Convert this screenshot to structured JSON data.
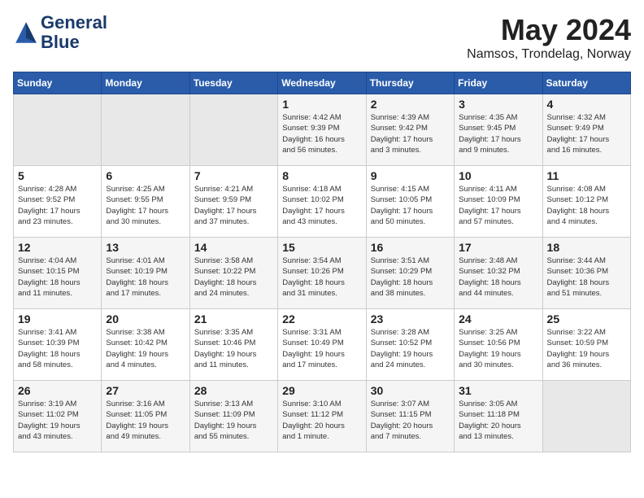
{
  "header": {
    "logo_line1": "General",
    "logo_line2": "Blue",
    "month_year": "May 2024",
    "location": "Namsos, Trondelag, Norway"
  },
  "days_of_week": [
    "Sunday",
    "Monday",
    "Tuesday",
    "Wednesday",
    "Thursday",
    "Friday",
    "Saturday"
  ],
  "weeks": [
    [
      {
        "day": "",
        "content": ""
      },
      {
        "day": "",
        "content": ""
      },
      {
        "day": "",
        "content": ""
      },
      {
        "day": "1",
        "content": "Sunrise: 4:42 AM\nSunset: 9:39 PM\nDaylight: 16 hours\nand 56 minutes."
      },
      {
        "day": "2",
        "content": "Sunrise: 4:39 AM\nSunset: 9:42 PM\nDaylight: 17 hours\nand 3 minutes."
      },
      {
        "day": "3",
        "content": "Sunrise: 4:35 AM\nSunset: 9:45 PM\nDaylight: 17 hours\nand 9 minutes."
      },
      {
        "day": "4",
        "content": "Sunrise: 4:32 AM\nSunset: 9:49 PM\nDaylight: 17 hours\nand 16 minutes."
      }
    ],
    [
      {
        "day": "5",
        "content": "Sunrise: 4:28 AM\nSunset: 9:52 PM\nDaylight: 17 hours\nand 23 minutes."
      },
      {
        "day": "6",
        "content": "Sunrise: 4:25 AM\nSunset: 9:55 PM\nDaylight: 17 hours\nand 30 minutes."
      },
      {
        "day": "7",
        "content": "Sunrise: 4:21 AM\nSunset: 9:59 PM\nDaylight: 17 hours\nand 37 minutes."
      },
      {
        "day": "8",
        "content": "Sunrise: 4:18 AM\nSunset: 10:02 PM\nDaylight: 17 hours\nand 43 minutes."
      },
      {
        "day": "9",
        "content": "Sunrise: 4:15 AM\nSunset: 10:05 PM\nDaylight: 17 hours\nand 50 minutes."
      },
      {
        "day": "10",
        "content": "Sunrise: 4:11 AM\nSunset: 10:09 PM\nDaylight: 17 hours\nand 57 minutes."
      },
      {
        "day": "11",
        "content": "Sunrise: 4:08 AM\nSunset: 10:12 PM\nDaylight: 18 hours\nand 4 minutes."
      }
    ],
    [
      {
        "day": "12",
        "content": "Sunrise: 4:04 AM\nSunset: 10:15 PM\nDaylight: 18 hours\nand 11 minutes."
      },
      {
        "day": "13",
        "content": "Sunrise: 4:01 AM\nSunset: 10:19 PM\nDaylight: 18 hours\nand 17 minutes."
      },
      {
        "day": "14",
        "content": "Sunrise: 3:58 AM\nSunset: 10:22 PM\nDaylight: 18 hours\nand 24 minutes."
      },
      {
        "day": "15",
        "content": "Sunrise: 3:54 AM\nSunset: 10:26 PM\nDaylight: 18 hours\nand 31 minutes."
      },
      {
        "day": "16",
        "content": "Sunrise: 3:51 AM\nSunset: 10:29 PM\nDaylight: 18 hours\nand 38 minutes."
      },
      {
        "day": "17",
        "content": "Sunrise: 3:48 AM\nSunset: 10:32 PM\nDaylight: 18 hours\nand 44 minutes."
      },
      {
        "day": "18",
        "content": "Sunrise: 3:44 AM\nSunset: 10:36 PM\nDaylight: 18 hours\nand 51 minutes."
      }
    ],
    [
      {
        "day": "19",
        "content": "Sunrise: 3:41 AM\nSunset: 10:39 PM\nDaylight: 18 hours\nand 58 minutes."
      },
      {
        "day": "20",
        "content": "Sunrise: 3:38 AM\nSunset: 10:42 PM\nDaylight: 19 hours\nand 4 minutes."
      },
      {
        "day": "21",
        "content": "Sunrise: 3:35 AM\nSunset: 10:46 PM\nDaylight: 19 hours\nand 11 minutes."
      },
      {
        "day": "22",
        "content": "Sunrise: 3:31 AM\nSunset: 10:49 PM\nDaylight: 19 hours\nand 17 minutes."
      },
      {
        "day": "23",
        "content": "Sunrise: 3:28 AM\nSunset: 10:52 PM\nDaylight: 19 hours\nand 24 minutes."
      },
      {
        "day": "24",
        "content": "Sunrise: 3:25 AM\nSunset: 10:56 PM\nDaylight: 19 hours\nand 30 minutes."
      },
      {
        "day": "25",
        "content": "Sunrise: 3:22 AM\nSunset: 10:59 PM\nDaylight: 19 hours\nand 36 minutes."
      }
    ],
    [
      {
        "day": "26",
        "content": "Sunrise: 3:19 AM\nSunset: 11:02 PM\nDaylight: 19 hours\nand 43 minutes."
      },
      {
        "day": "27",
        "content": "Sunrise: 3:16 AM\nSunset: 11:05 PM\nDaylight: 19 hours\nand 49 minutes."
      },
      {
        "day": "28",
        "content": "Sunrise: 3:13 AM\nSunset: 11:09 PM\nDaylight: 19 hours\nand 55 minutes."
      },
      {
        "day": "29",
        "content": "Sunrise: 3:10 AM\nSunset: 11:12 PM\nDaylight: 20 hours\nand 1 minute."
      },
      {
        "day": "30",
        "content": "Sunrise: 3:07 AM\nSunset: 11:15 PM\nDaylight: 20 hours\nand 7 minutes."
      },
      {
        "day": "31",
        "content": "Sunrise: 3:05 AM\nSunset: 11:18 PM\nDaylight: 20 hours\nand 13 minutes."
      },
      {
        "day": "",
        "content": ""
      }
    ]
  ]
}
